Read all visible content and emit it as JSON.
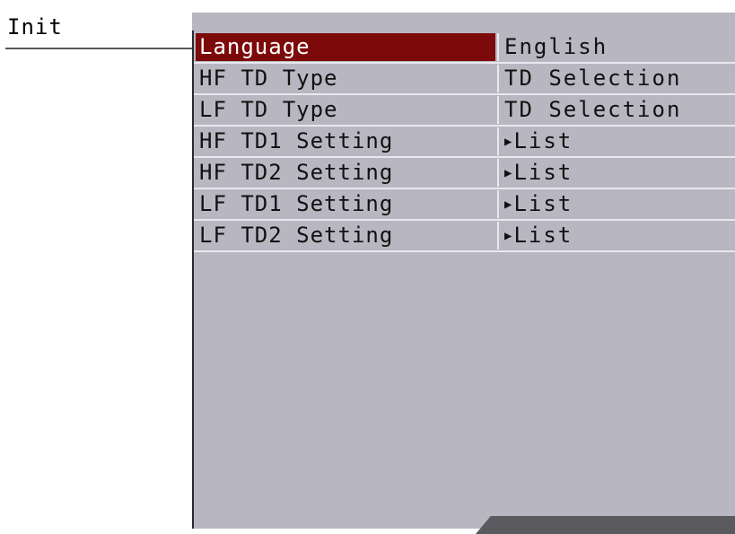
{
  "window": {
    "tab_title": "Init"
  },
  "settings": {
    "rows": [
      {
        "label": "Language",
        "value": "English",
        "has_arrow": false,
        "selected": true
      },
      {
        "label": "HF TD Type",
        "value": "TD Selection",
        "has_arrow": false,
        "selected": false
      },
      {
        "label": "LF TD Type",
        "value": "TD Selection",
        "has_arrow": false,
        "selected": false
      },
      {
        "label": "HF TD1 Setting",
        "value": "List",
        "has_arrow": true,
        "selected": false
      },
      {
        "label": "HF TD2 Setting",
        "value": "List",
        "has_arrow": true,
        "selected": false
      },
      {
        "label": "LF TD1 Setting",
        "value": "List",
        "has_arrow": true,
        "selected": false
      },
      {
        "label": "LF TD2 Setting",
        "value": "List",
        "has_arrow": true,
        "selected": false
      }
    ]
  },
  "colors": {
    "panel_bg": "#b8b7c1",
    "selected_bg": "#7d0a0a",
    "selected_fg": "#ffffff",
    "text": "#111111"
  }
}
